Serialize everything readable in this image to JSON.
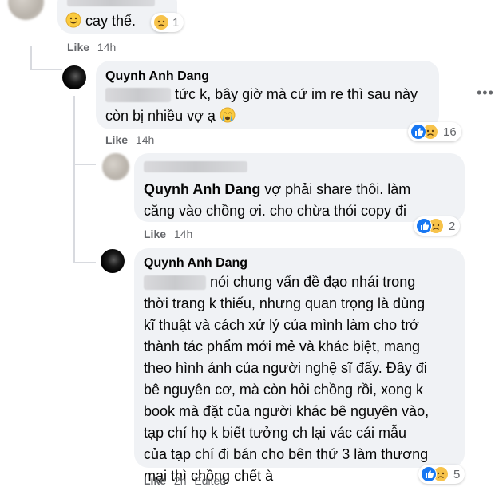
{
  "comment_top": {
    "text_emoji": "🙂",
    "text": "cay thế.",
    "reaction_count": "1",
    "like_label": "Like",
    "time": "14h"
  },
  "reply1": {
    "author": "Quynh Anh Dang",
    "line1": "tức k, bây giờ mà cứ im re thì sau này",
    "line2": "còn bị nhiều vợ ạ",
    "reaction_count": "16",
    "like_label": "Like",
    "time": "14h"
  },
  "reply2": {
    "author": "Quynh Anh Dang",
    "line1_rest": "vợ phải share thôi. làm",
    "line2": "căng vào chồng ơi. cho chừa thói copy đi",
    "reaction_count": "2",
    "like_label": "Like",
    "time": "14h"
  },
  "reply3": {
    "author": "Quynh Anh Dang",
    "line1_rest": "nói chung vấn đề đạo nhái trong",
    "lines": [
      "thời trang k thiếu, nhưng quan trọng là dùng",
      "kĩ thuật và cách xử lý của mình làm cho trở",
      "thành tác phẩm mới mẻ và khác biệt, mang",
      "theo hình ảnh của người nghệ sĩ đấy. Đây đi",
      "bê nguyên cơ, mà còn hỏi chồng rồi, xong k",
      "book mà đặt của người khác bê nguyên vào,",
      "tạp chí họ k biết tưởng ch lại vác cái mẫu",
      "của tạp chí đi bán cho bên thứ 3 làm thương",
      "mại thì chồng chết à"
    ],
    "reaction_count": "5",
    "like_label": "Like",
    "time": "2h",
    "edited_label": "Edited"
  },
  "colors": {
    "bubble": "#f0f2f5",
    "meta": "#65676b",
    "like_blue": "#1877f2",
    "sad_yellow": "#f7c34b"
  },
  "icons": [
    "slightly-smiling-emoji",
    "crying-emoji",
    "like-reaction-icon",
    "sad-reaction-icon",
    "more-options-icon"
  ]
}
